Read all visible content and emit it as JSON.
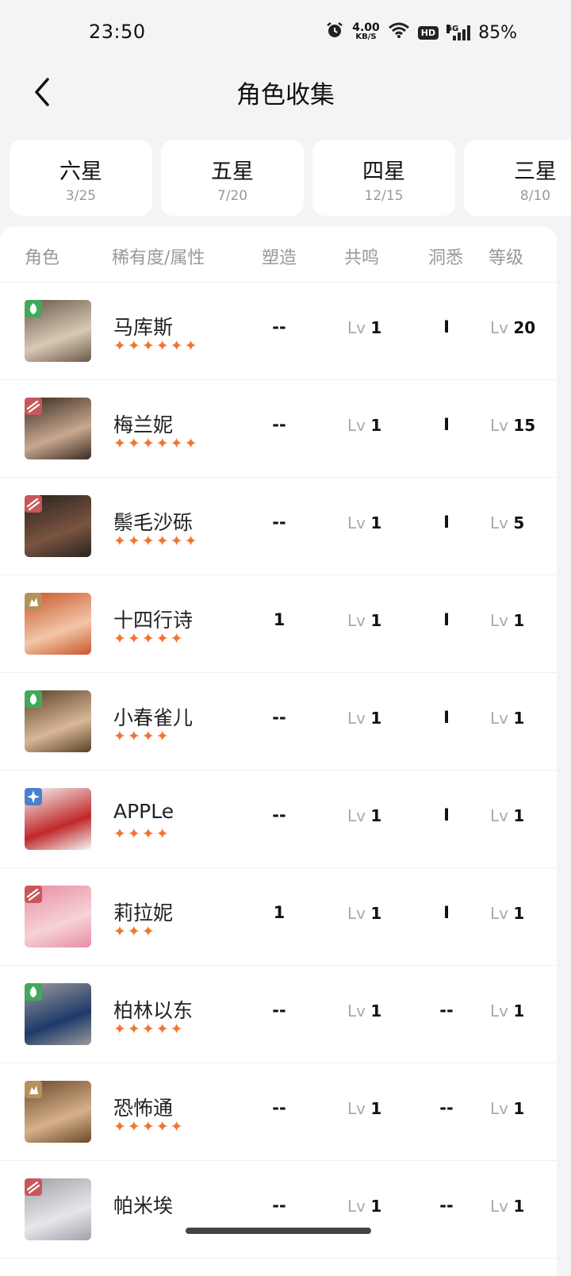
{
  "status": {
    "time": "23:50",
    "net_speed": "4.00",
    "net_unit": "KB/S",
    "hd": "HD",
    "network": "5G",
    "battery": "85%"
  },
  "header": {
    "title": "角色收集"
  },
  "tabs": [
    {
      "label": "六星",
      "count": "3/25"
    },
    {
      "label": "五星",
      "count": "7/20"
    },
    {
      "label": "四星",
      "count": "12/15"
    },
    {
      "label": "三星",
      "count": "8/10"
    }
  ],
  "columns": {
    "character": "角色",
    "rarity_attr": "稀有度/属性",
    "shaping": "塑造",
    "resonance": "共鸣",
    "insight": "洞悉",
    "level": "等级"
  },
  "characters": [
    {
      "name": "马库斯",
      "stars": "✦✦✦✦✦✦",
      "attribute_icon": "plant-icon",
      "shaping": "--",
      "resonance_prefix": "Lv",
      "resonance": "1",
      "insight": "I",
      "level_prefix": "Lv",
      "level": "20"
    },
    {
      "name": "梅兰妮",
      "stars": "✦✦✦✦✦✦",
      "attribute_icon": "beast-icon",
      "shaping": "--",
      "resonance_prefix": "Lv",
      "resonance": "1",
      "insight": "I",
      "level_prefix": "Lv",
      "level": "15"
    },
    {
      "name": "鬃毛沙砾",
      "stars": "✦✦✦✦✦✦",
      "attribute_icon": "beast-icon",
      "shaping": "--",
      "resonance_prefix": "Lv",
      "resonance": "1",
      "insight": "I",
      "level_prefix": "Lv",
      "level": "5"
    },
    {
      "name": "十四行诗",
      "stars": "✦✦✦✦✦",
      "attribute_icon": "mineral-icon",
      "shaping": "1",
      "resonance_prefix": "Lv",
      "resonance": "1",
      "insight": "I",
      "level_prefix": "Lv",
      "level": "1"
    },
    {
      "name": "小春雀儿",
      "stars": "✦✦✦✦",
      "attribute_icon": "plant-icon",
      "shaping": "--",
      "resonance_prefix": "Lv",
      "resonance": "1",
      "insight": "I",
      "level_prefix": "Lv",
      "level": "1"
    },
    {
      "name": "APPLe",
      "stars": "✦✦✦✦",
      "attribute_icon": "star-icon",
      "shaping": "--",
      "resonance_prefix": "Lv",
      "resonance": "1",
      "insight": "I",
      "level_prefix": "Lv",
      "level": "1"
    },
    {
      "name": "莉拉妮",
      "stars": "✦✦✦",
      "attribute_icon": "beast-icon",
      "shaping": "1",
      "resonance_prefix": "Lv",
      "resonance": "1",
      "insight": "I",
      "level_prefix": "Lv",
      "level": "1"
    },
    {
      "name": "柏林以东",
      "stars": "✦✦✦✦✦",
      "attribute_icon": "plant-icon",
      "shaping": "--",
      "resonance_prefix": "Lv",
      "resonance": "1",
      "insight": "--",
      "level_prefix": "Lv",
      "level": "1"
    },
    {
      "name": "恐怖通",
      "stars": "✦✦✦✦✦",
      "attribute_icon": "mineral-icon",
      "shaping": "--",
      "resonance_prefix": "Lv",
      "resonance": "1",
      "insight": "--",
      "level_prefix": "Lv",
      "level": "1"
    },
    {
      "name": "帕米埃",
      "stars": "",
      "attribute_icon": "beast-icon",
      "shaping": "--",
      "resonance_prefix": "Lv",
      "resonance": "1",
      "insight": "--",
      "level_prefix": "Lv",
      "level": "1"
    }
  ],
  "colors": {
    "star": "#f07532",
    "plant": "#43a85a",
    "beast": "#c8575a",
    "mineral": "#b4925a",
    "star_attr": "#4a80d0"
  }
}
